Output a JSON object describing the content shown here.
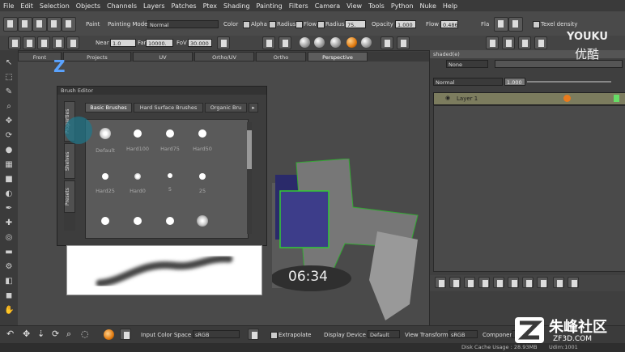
{
  "menu": [
    "File",
    "Edit",
    "Selection",
    "Objects",
    "Channels",
    "Layers",
    "Patches",
    "Ptex",
    "Shading",
    "Painting",
    "Filters",
    "Camera",
    "View",
    "Tools",
    "Python",
    "Nuke",
    "Help"
  ],
  "toolbar": {
    "paint_label": "Paint",
    "painting_mode_label": "Painting Mode",
    "painting_mode_value": "Normal",
    "color_label": "Color",
    "alpha_label": "Alpha",
    "radius_label": "Radius",
    "flow_label": "Flow",
    "radius2_label": "Radius",
    "radius2_value": "75.",
    "opacity_label": "Opacity",
    "opacity_value": "1.000",
    "flow2_label": "Flow",
    "flow2_value": "0.486",
    "flat_label": "Fla",
    "texel_density_label": "Texel density"
  },
  "toolbar2": {
    "near_label": "Near",
    "near_value": "1.0",
    "far_label": "Far",
    "far_value": "10000.",
    "fov_label": "FoV",
    "fov_value": "30.000"
  },
  "tabs": [
    "Front",
    "Projects",
    "UV",
    "Ortho/UV",
    "Ortho",
    "Perspective"
  ],
  "active_tab": "Perspective",
  "brush_editor": {
    "title": "Brush Editor",
    "side_tabs": [
      "Properties",
      "Shelves",
      "Presets"
    ],
    "tabs": [
      "Basic Brushes",
      "Hard Surface Brushes",
      "Organic Bru"
    ],
    "brushes": [
      "Default",
      "Hard100",
      "Hard75",
      "Hard50",
      "Hard25",
      "Hard0",
      "5",
      "25",
      "",
      "",
      "",
      ""
    ]
  },
  "right_panel": {
    "header": "shaded(e)",
    "search_value": "None",
    "blend_mode": "Normal",
    "opacity_value": "1.000",
    "layer_name": "Layer 1"
  },
  "statusbar": {
    "input_color_space_label": "Input Color Space",
    "input_color_space_value": "sRGB",
    "extrapolate_label": "Extrapolate",
    "display_device_label": "Display Device",
    "display_device_value": "Default",
    "view_transform_label": "View Transform",
    "view_transform_value": "sRGB",
    "component_label": "Component"
  },
  "bottomline": {
    "disk_cache": "Disk Cache Usage : 28.93MB",
    "udim": "Udim:1001"
  },
  "overlay": {
    "timestamp": "06:34",
    "youku": "YOUKU",
    "youku_cn": "优酷",
    "zf_text": "朱峰社区",
    "zf_sub": "ZF3D.COM"
  }
}
